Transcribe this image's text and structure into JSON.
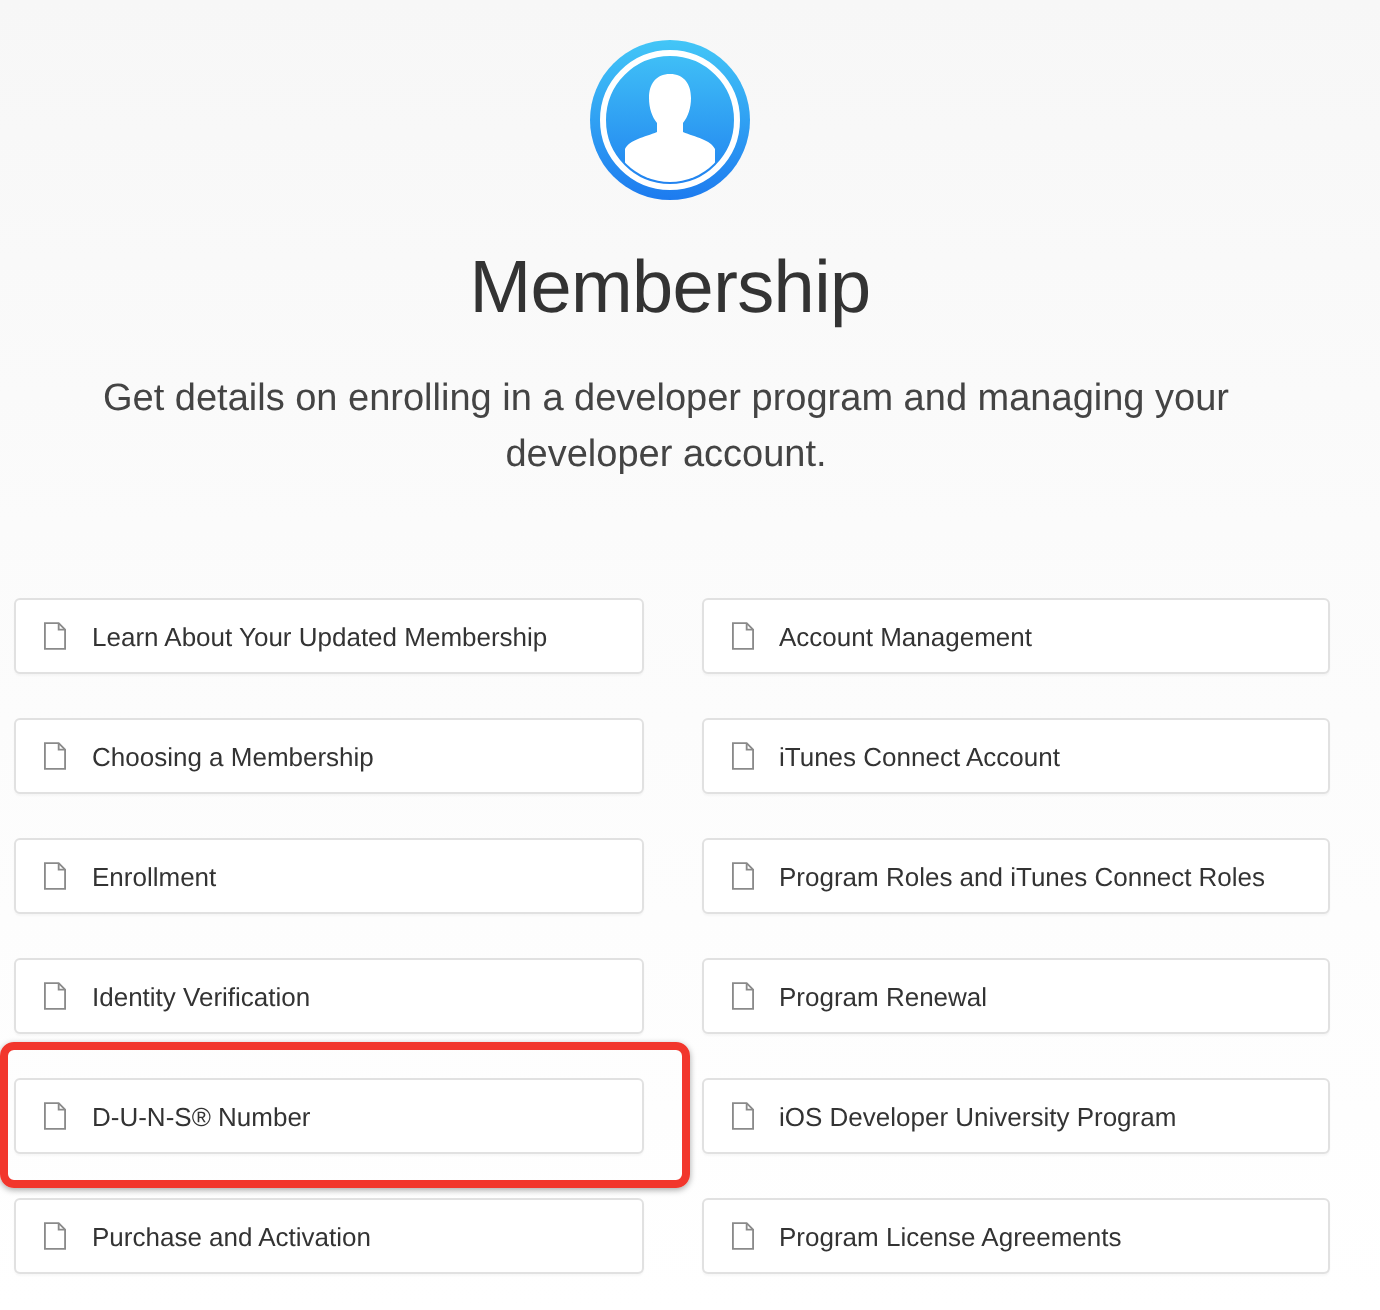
{
  "header": {
    "title": "Membership",
    "subtitle": "Get details on enrolling in a developer program and managing your developer account."
  },
  "columns": [
    {
      "links": [
        {
          "label": "Learn About Your Updated Membership",
          "highlighted": false
        },
        {
          "label": "Choosing a Membership",
          "highlighted": false
        },
        {
          "label": "Enrollment",
          "highlighted": false
        },
        {
          "label": "Identity Verification",
          "highlighted": false
        },
        {
          "label": "D-U-N-S® Number",
          "highlighted": true
        },
        {
          "label": "Purchase and Activation",
          "highlighted": false
        }
      ]
    },
    {
      "links": [
        {
          "label": "Account Management",
          "highlighted": false
        },
        {
          "label": "iTunes Connect Account",
          "highlighted": false
        },
        {
          "label": "Program Roles and iTunes Connect Roles",
          "highlighted": false
        },
        {
          "label": "Program Renewal",
          "highlighted": false
        },
        {
          "label": "iOS Developer University Program",
          "highlighted": false
        },
        {
          "label": "Program License Agreements",
          "highlighted": false
        }
      ]
    }
  ]
}
